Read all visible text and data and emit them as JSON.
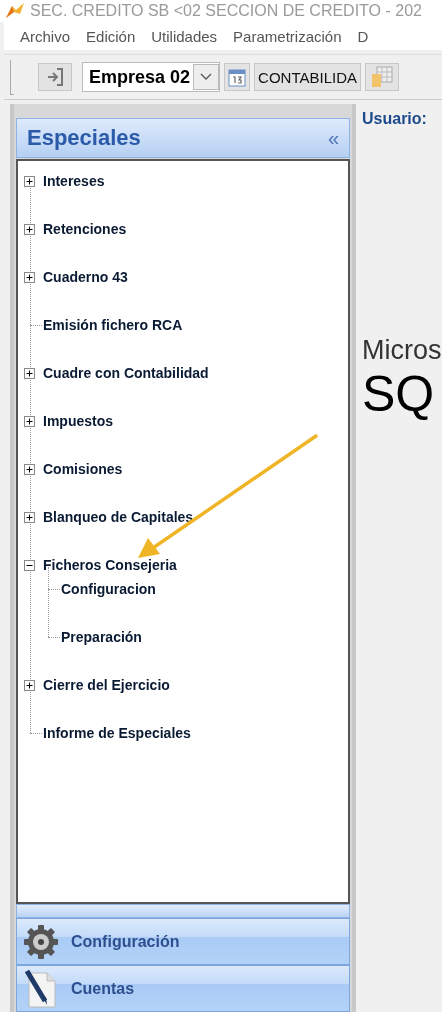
{
  "window": {
    "title": "SEC. CREDITO SB <02 SECCION DE CREDITO - 202"
  },
  "menu": [
    "Archivo",
    "Edición",
    "Utilidades",
    "Parametrización",
    "D"
  ],
  "toolbar": {
    "company": "Empresa 02",
    "module_button": "CONTABILIDA"
  },
  "panel": {
    "title": "Especiales",
    "collapse": "«",
    "tree": [
      {
        "label": "Intereses",
        "kind": "group",
        "expanded": false
      },
      {
        "label": "Retenciones",
        "kind": "group",
        "expanded": false
      },
      {
        "label": "Cuaderno 43",
        "kind": "group",
        "expanded": false
      },
      {
        "label": "Emisión fichero RCA",
        "kind": "leaf"
      },
      {
        "label": "Cuadre con Contabilidad",
        "kind": "group",
        "expanded": false
      },
      {
        "label": "Impuestos",
        "kind": "group",
        "expanded": false
      },
      {
        "label": "Comisiones",
        "kind": "group",
        "expanded": false
      },
      {
        "label": "Blanqueo de Capitales",
        "kind": "group",
        "expanded": false
      },
      {
        "label": "Ficheros Consejeria",
        "kind": "group",
        "expanded": true,
        "children": [
          {
            "label": "Configuracion",
            "kind": "leaf"
          },
          {
            "label": "Preparación",
            "kind": "leaf"
          }
        ]
      },
      {
        "label": "Cierre del Ejercicio",
        "kind": "group",
        "expanded": false
      },
      {
        "label": "Informe de Especiales",
        "kind": "leaf"
      }
    ],
    "sections": [
      {
        "label": "Configuración",
        "kind": "gear"
      },
      {
        "label": "Cuentas",
        "kind": "document"
      }
    ]
  },
  "content": {
    "user_label": "Usuario:",
    "logo_top": "Micros",
    "logo_bottom": "SQ"
  }
}
